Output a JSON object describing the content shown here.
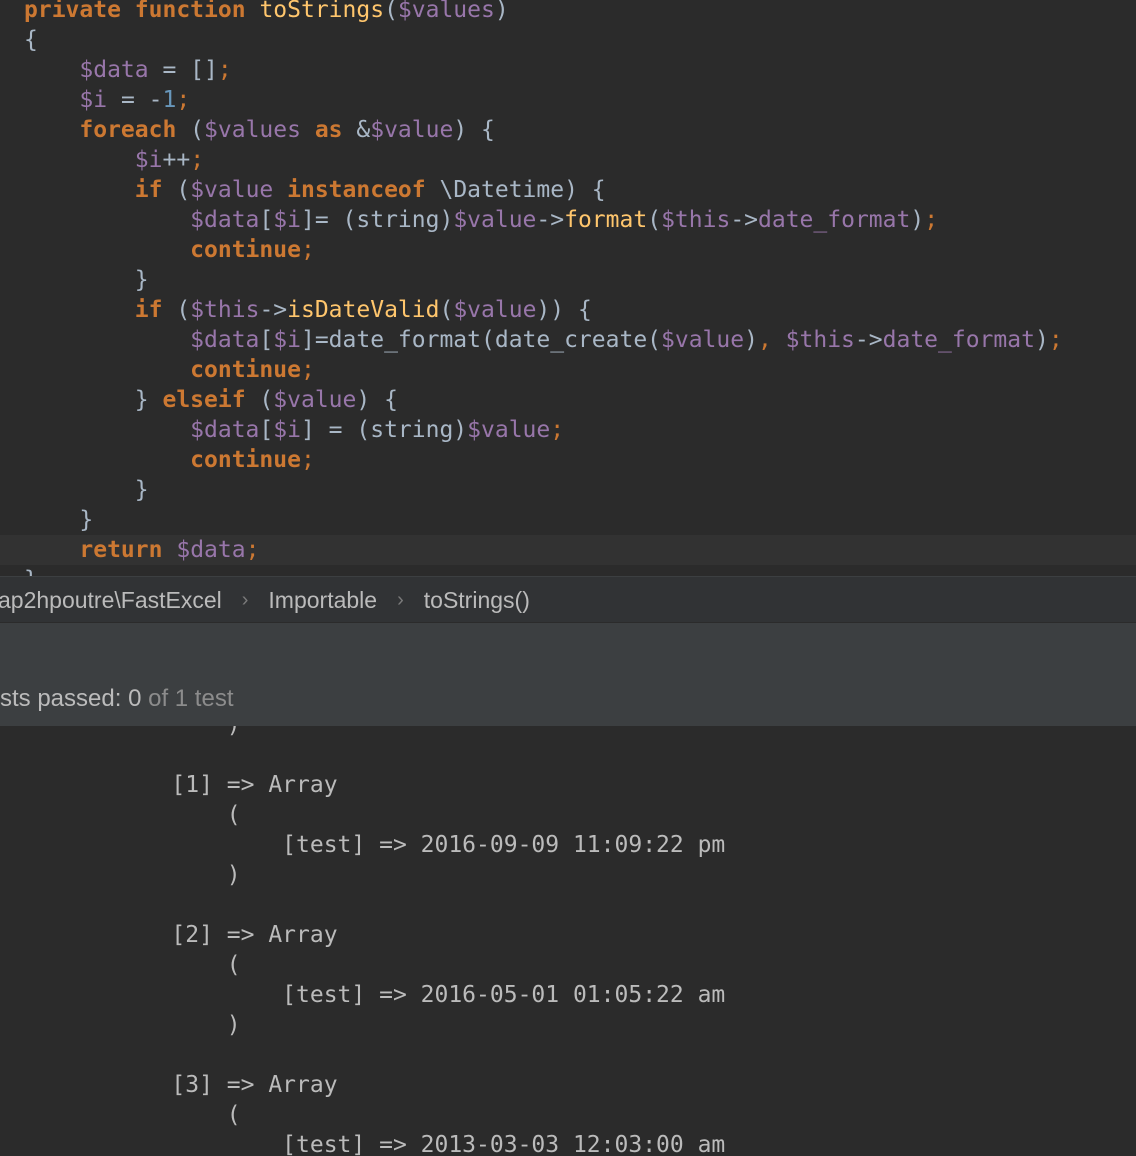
{
  "editor": {
    "lines": [
      {
        "segments": [
          {
            "t": "",
            "c": "pl"
          },
          {
            "t": "private",
            "c": "kw"
          },
          {
            "t": " ",
            "c": "pl"
          },
          {
            "t": "function",
            "c": "kw"
          },
          {
            "t": " ",
            "c": "pl"
          },
          {
            "t": "toStrings",
            "c": "fn"
          },
          {
            "t": "(",
            "c": "pl"
          },
          {
            "t": "$values",
            "c": "var"
          },
          {
            "t": ")",
            "c": "pl"
          }
        ]
      },
      {
        "segments": [
          {
            "t": "{",
            "c": "pl"
          }
        ]
      },
      {
        "segments": [
          {
            "t": "    ",
            "c": "pl"
          },
          {
            "t": "$data",
            "c": "var"
          },
          {
            "t": " = []",
            "c": "pl"
          },
          {
            "t": ";",
            "c": "sep"
          }
        ]
      },
      {
        "segments": [
          {
            "t": "    ",
            "c": "pl"
          },
          {
            "t": "$i",
            "c": "var"
          },
          {
            "t": " = -",
            "c": "pl"
          },
          {
            "t": "1",
            "c": "num"
          },
          {
            "t": ";",
            "c": "sep"
          }
        ]
      },
      {
        "segments": [
          {
            "t": "    ",
            "c": "pl"
          },
          {
            "t": "foreach",
            "c": "kw"
          },
          {
            "t": " (",
            "c": "pl"
          },
          {
            "t": "$values",
            "c": "var"
          },
          {
            "t": " ",
            "c": "pl"
          },
          {
            "t": "as",
            "c": "kw"
          },
          {
            "t": " &",
            "c": "pl"
          },
          {
            "t": "$value",
            "c": "var"
          },
          {
            "t": ") {",
            "c": "pl"
          }
        ]
      },
      {
        "segments": [
          {
            "t": "        ",
            "c": "pl"
          },
          {
            "t": "$i",
            "c": "var"
          },
          {
            "t": "++",
            "c": "pl"
          },
          {
            "t": ";",
            "c": "sep"
          }
        ]
      },
      {
        "segments": [
          {
            "t": "        ",
            "c": "pl"
          },
          {
            "t": "if",
            "c": "kw"
          },
          {
            "t": " (",
            "c": "pl"
          },
          {
            "t": "$value",
            "c": "var"
          },
          {
            "t": " ",
            "c": "pl"
          },
          {
            "t": "instanceof",
            "c": "kw"
          },
          {
            "t": " \\Datetime) {",
            "c": "pl"
          }
        ]
      },
      {
        "segments": [
          {
            "t": "            ",
            "c": "pl"
          },
          {
            "t": "$data",
            "c": "var"
          },
          {
            "t": "[",
            "c": "pl"
          },
          {
            "t": "$i",
            "c": "var"
          },
          {
            "t": "]= (string)",
            "c": "pl"
          },
          {
            "t": "$value",
            "c": "var"
          },
          {
            "t": "->",
            "c": "pl"
          },
          {
            "t": "format",
            "c": "fn"
          },
          {
            "t": "(",
            "c": "pl"
          },
          {
            "t": "$this",
            "c": "var"
          },
          {
            "t": "->",
            "c": "pl"
          },
          {
            "t": "date_format",
            "c": "var"
          },
          {
            "t": ")",
            "c": "pl"
          },
          {
            "t": ";",
            "c": "sep"
          }
        ]
      },
      {
        "segments": [
          {
            "t": "            ",
            "c": "pl"
          },
          {
            "t": "continue",
            "c": "kw"
          },
          {
            "t": ";",
            "c": "sep"
          }
        ]
      },
      {
        "segments": [
          {
            "t": "        }",
            "c": "pl"
          }
        ]
      },
      {
        "segments": [
          {
            "t": "        ",
            "c": "pl"
          },
          {
            "t": "if",
            "c": "kw"
          },
          {
            "t": " (",
            "c": "pl"
          },
          {
            "t": "$this",
            "c": "var"
          },
          {
            "t": "->",
            "c": "pl"
          },
          {
            "t": "isDateValid",
            "c": "fn"
          },
          {
            "t": "(",
            "c": "pl"
          },
          {
            "t": "$value",
            "c": "var"
          },
          {
            "t": ")) {",
            "c": "pl"
          }
        ]
      },
      {
        "segments": [
          {
            "t": "            ",
            "c": "pl"
          },
          {
            "t": "$data",
            "c": "var"
          },
          {
            "t": "[",
            "c": "pl"
          },
          {
            "t": "$i",
            "c": "var"
          },
          {
            "t": "]=date_format(date_create(",
            "c": "pl"
          },
          {
            "t": "$value",
            "c": "var"
          },
          {
            "t": ")",
            "c": "pl"
          },
          {
            "t": ", ",
            "c": "sep"
          },
          {
            "t": "$this",
            "c": "var"
          },
          {
            "t": "->",
            "c": "pl"
          },
          {
            "t": "date_format",
            "c": "var"
          },
          {
            "t": ")",
            "c": "pl"
          },
          {
            "t": ";",
            "c": "sep"
          }
        ]
      },
      {
        "segments": [
          {
            "t": "            ",
            "c": "pl"
          },
          {
            "t": "continue",
            "c": "kw"
          },
          {
            "t": ";",
            "c": "sep"
          }
        ]
      },
      {
        "segments": [
          {
            "t": "        } ",
            "c": "pl"
          },
          {
            "t": "elseif",
            "c": "kw"
          },
          {
            "t": " (",
            "c": "pl"
          },
          {
            "t": "$value",
            "c": "var"
          },
          {
            "t": ") {",
            "c": "pl"
          }
        ]
      },
      {
        "segments": [
          {
            "t": "            ",
            "c": "pl"
          },
          {
            "t": "$data",
            "c": "var"
          },
          {
            "t": "[",
            "c": "pl"
          },
          {
            "t": "$i",
            "c": "var"
          },
          {
            "t": "] = (string)",
            "c": "pl"
          },
          {
            "t": "$value",
            "c": "var"
          },
          {
            "t": ";",
            "c": "sep"
          }
        ]
      },
      {
        "segments": [
          {
            "t": "            ",
            "c": "pl"
          },
          {
            "t": "continue",
            "c": "kw"
          },
          {
            "t": ";",
            "c": "sep"
          }
        ]
      },
      {
        "segments": [
          {
            "t": "        }",
            "c": "pl"
          }
        ]
      },
      {
        "segments": [
          {
            "t": "    }",
            "c": "pl"
          }
        ]
      },
      {
        "segments": [
          {
            "t": "    ",
            "c": "pl"
          },
          {
            "t": "return",
            "c": "kw"
          },
          {
            "t": " ",
            "c": "pl"
          },
          {
            "t": "$data",
            "c": "var"
          },
          {
            "t": ";",
            "c": "sep"
          }
        ]
      },
      {
        "segments": [
          {
            "t": "}",
            "c": "pl"
          }
        ]
      }
    ],
    "current_line_index": 18
  },
  "breadcrumb": {
    "items": [
      "ap2hpoutre\\FastExcel",
      "Importable",
      "toStrings()"
    ],
    "separator": "›"
  },
  "test_status": {
    "prefix": "sts passed: ",
    "passed": "0",
    "of_word": " of ",
    "total": "1 test"
  },
  "console": {
    "lines": [
      "        )",
      "",
      "    [1] => Array",
      "        (",
      "            [test] => 2016-09-09 11:09:22 pm",
      "        )",
      "",
      "    [2] => Array",
      "        (",
      "            [test] => 2016-05-01 01:05:22 am",
      "        )",
      "",
      "    [3] => Array",
      "        (",
      "            [test] => 2013-03-03 12:03:00 am"
    ]
  }
}
